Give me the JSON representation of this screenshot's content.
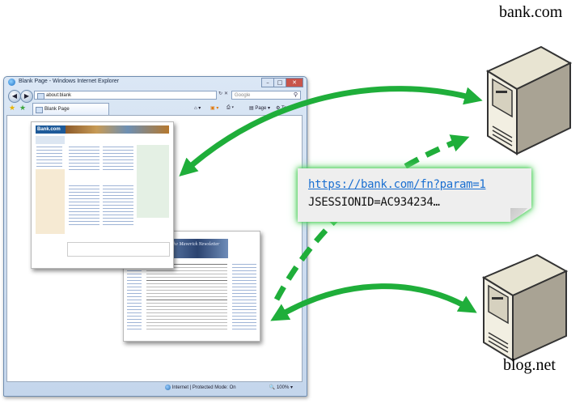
{
  "browser": {
    "title": "Blank Page - Windows Internet Explorer",
    "address": "about:blank",
    "search_placeholder": "Google",
    "tab_label": "Blank Page",
    "page_menu": "Page",
    "tools_menu": "Tools",
    "status": "Internet | Protected Mode: On",
    "zoom": "100%"
  },
  "thumbnails": {
    "bank_logo": "Bank.com",
    "blog_title": "The Maverick Newsletter"
  },
  "servers": {
    "bank_label": "bank.com",
    "blog_label": "blog.net"
  },
  "callout": {
    "url": "https://bank.com/fn?param=1",
    "cookie": "JSESSIONID=AC934234…"
  },
  "colors": {
    "arrow": "#1fae3a",
    "link": "#1a6fd1",
    "callout_bg": "#eeeeee",
    "glow": "#3cc84b"
  },
  "icons": [
    "back-icon",
    "forward-icon",
    "refresh-icon",
    "stop-icon",
    "search-icon",
    "favorites-star-icon",
    "home-icon",
    "rss-icon",
    "print-icon",
    "globe-icon",
    "server-icon"
  ]
}
